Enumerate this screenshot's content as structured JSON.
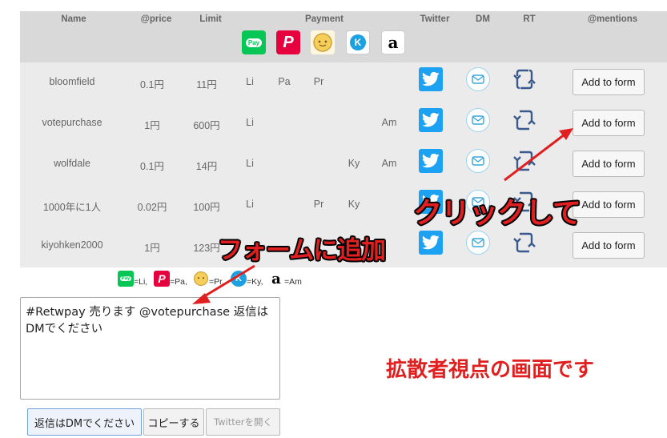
{
  "table": {
    "headers": {
      "name": "Name",
      "price": "@price",
      "limit": "Limit",
      "payment": "Payment",
      "twitter": "Twitter",
      "dm": "DM",
      "rt": "RT",
      "mentions": "@mentions"
    },
    "payment_logos": [
      {
        "icon": "line-pay-icon",
        "text": "Pay",
        "color": "#06c755"
      },
      {
        "icon": "paypay-icon",
        "text": "P",
        "color": "#e6003e"
      },
      {
        "icon": "pring-icon",
        "text": "",
        "color": "#d8b25a"
      },
      {
        "icon": "kyash-icon",
        "text": "K",
        "color": "#1ba1e2"
      },
      {
        "icon": "amazon-icon",
        "text": "a",
        "color": "#000000"
      }
    ],
    "rows": [
      {
        "name": "bloomfield",
        "price": "0.1円",
        "limit": "11円",
        "li": "Li",
        "pa": "Pa",
        "pr": "Pr",
        "ky": "",
        "am": "",
        "add": "Add to form"
      },
      {
        "name": "votepurchase",
        "price": "1円",
        "limit": "600円",
        "li": "Li",
        "pa": "",
        "pr": "",
        "ky": "",
        "am": "Am",
        "add": "Add to form"
      },
      {
        "name": "wolfdale",
        "price": "0.1円",
        "limit": "14円",
        "li": "Li",
        "pa": "",
        "pr": "",
        "ky": "Ky",
        "am": "Am",
        "add": "Add to form"
      },
      {
        "name": "1000年に1人",
        "price": "0.02円",
        "limit": "100円",
        "li": "Li",
        "pa": "",
        "pr": "Pr",
        "ky": "Ky",
        "am": "",
        "add": "Add to form"
      },
      {
        "name": "kiyohken2000",
        "price": "1円",
        "limit": "123円",
        "li": "",
        "pa": "",
        "pr": "",
        "ky": "",
        "am": "",
        "add": "Add to form"
      }
    ]
  },
  "legend": [
    {
      "icon": "line-pay-icon",
      "label": "=Li,"
    },
    {
      "icon": "paypay-icon",
      "label": "=Pa,"
    },
    {
      "icon": "pring-icon",
      "label": "=Pr,"
    },
    {
      "icon": "kyash-icon",
      "label": "=Ky,"
    },
    {
      "icon": "amazon-icon",
      "label": "=Am"
    }
  ],
  "tweet_text": "#Retwpay 売ります @votepurchase 返信はDMでください",
  "buttons": {
    "reply_dm": "返信はDMでください",
    "copy": "コピーする",
    "open_twitter": "Twitterを開く"
  },
  "annotations": {
    "click": "クリックして",
    "add_to_form": "フォームに追加",
    "spreader_view": "拡散者視点の画面です"
  },
  "colors": {
    "header_bg": "#d9d9d9",
    "body_bg": "#ebebeb",
    "twitter_blue": "#1da1f2",
    "annotation_red": "#e02020"
  }
}
